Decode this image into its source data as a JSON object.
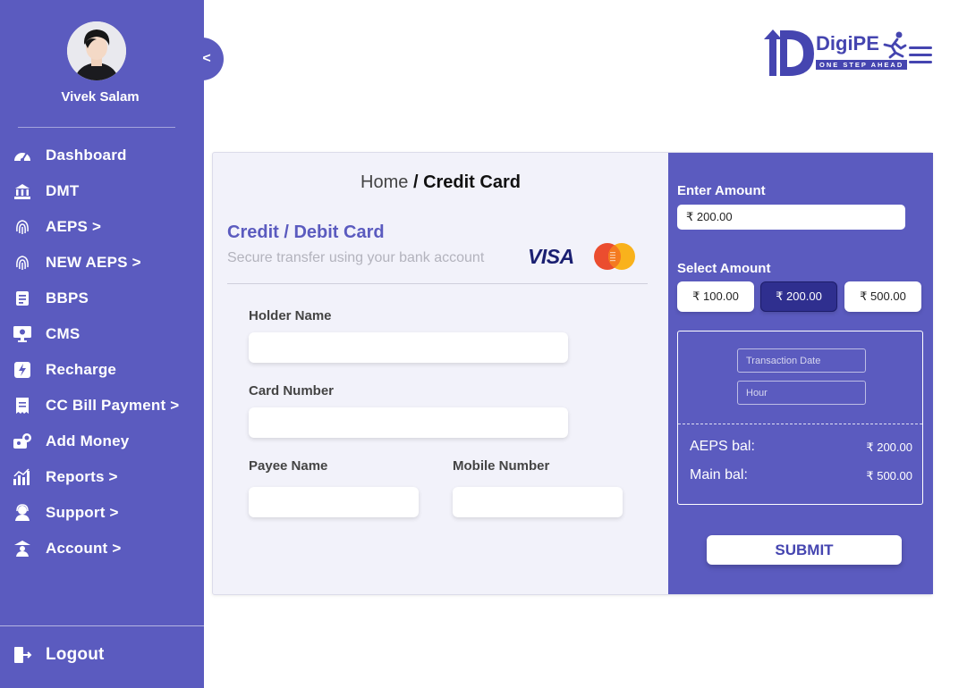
{
  "user": {
    "name": "Vivek Salam"
  },
  "sidebar": {
    "collapse_label": "<",
    "items": [
      {
        "label": "Dashboard",
        "icon": "speedometer-icon"
      },
      {
        "label": "DMT",
        "icon": "bank-transfer-icon"
      },
      {
        "label": "AEPS >",
        "icon": "fingerprint-icon"
      },
      {
        "label": "NEW AEPS >",
        "icon": "fingerprint-icon"
      },
      {
        "label": "BBPS",
        "icon": "bill-icon"
      },
      {
        "label": "CMS",
        "icon": "monitor-icon"
      },
      {
        "label": "Recharge",
        "icon": "lightning-icon"
      },
      {
        "label": "CC Bill Payment >",
        "icon": "receipt-icon"
      },
      {
        "label": "Add Money",
        "icon": "wallet-icon"
      },
      {
        "label": "Reports >",
        "icon": "chart-icon"
      },
      {
        "label": "Support >",
        "icon": "support-icon"
      },
      {
        "label": "Account >",
        "icon": "account-icon"
      }
    ],
    "logout_label": "Logout"
  },
  "logo": {
    "name": "DigiPE",
    "tagline": "ONE STEP AHEAD"
  },
  "breadcrumb": {
    "home": "Home",
    "separator": " / ",
    "current": "Credit Card"
  },
  "form": {
    "title": "Credit / Debit Card",
    "subtitle": "Secure transfer using your bank account",
    "visa_label": "VISA",
    "holder_name_label": "Holder Name",
    "holder_name_value": "",
    "card_number_label": "Card Number",
    "card_number_value": "",
    "payee_name_label": "Payee Name",
    "payee_name_value": "",
    "mobile_number_label": "Mobile Number",
    "mobile_number_value": ""
  },
  "amount": {
    "enter_label": "Enter Amount",
    "value": "₹ 200.00",
    "select_label": "Select Amount",
    "options": [
      "₹ 100.00",
      "₹ 200.00",
      "₹ 500.00"
    ],
    "selected": "₹ 200.00"
  },
  "details": {
    "transaction_date_placeholder": "Transaction Date",
    "hour_placeholder": "Hour",
    "aeps_label": "AEPS bal:",
    "aeps_value": "₹ 200.00",
    "main_label": "Main bal:",
    "main_value": "₹ 500.00"
  },
  "submit_label": "SUBMIT",
  "colors": {
    "primary": "#5b5bbf",
    "selected": "#2f2f8f",
    "panel_bg": "#f2f2fa",
    "mc_red": "#eb4d2f",
    "mc_yellow": "#f9b21c"
  }
}
